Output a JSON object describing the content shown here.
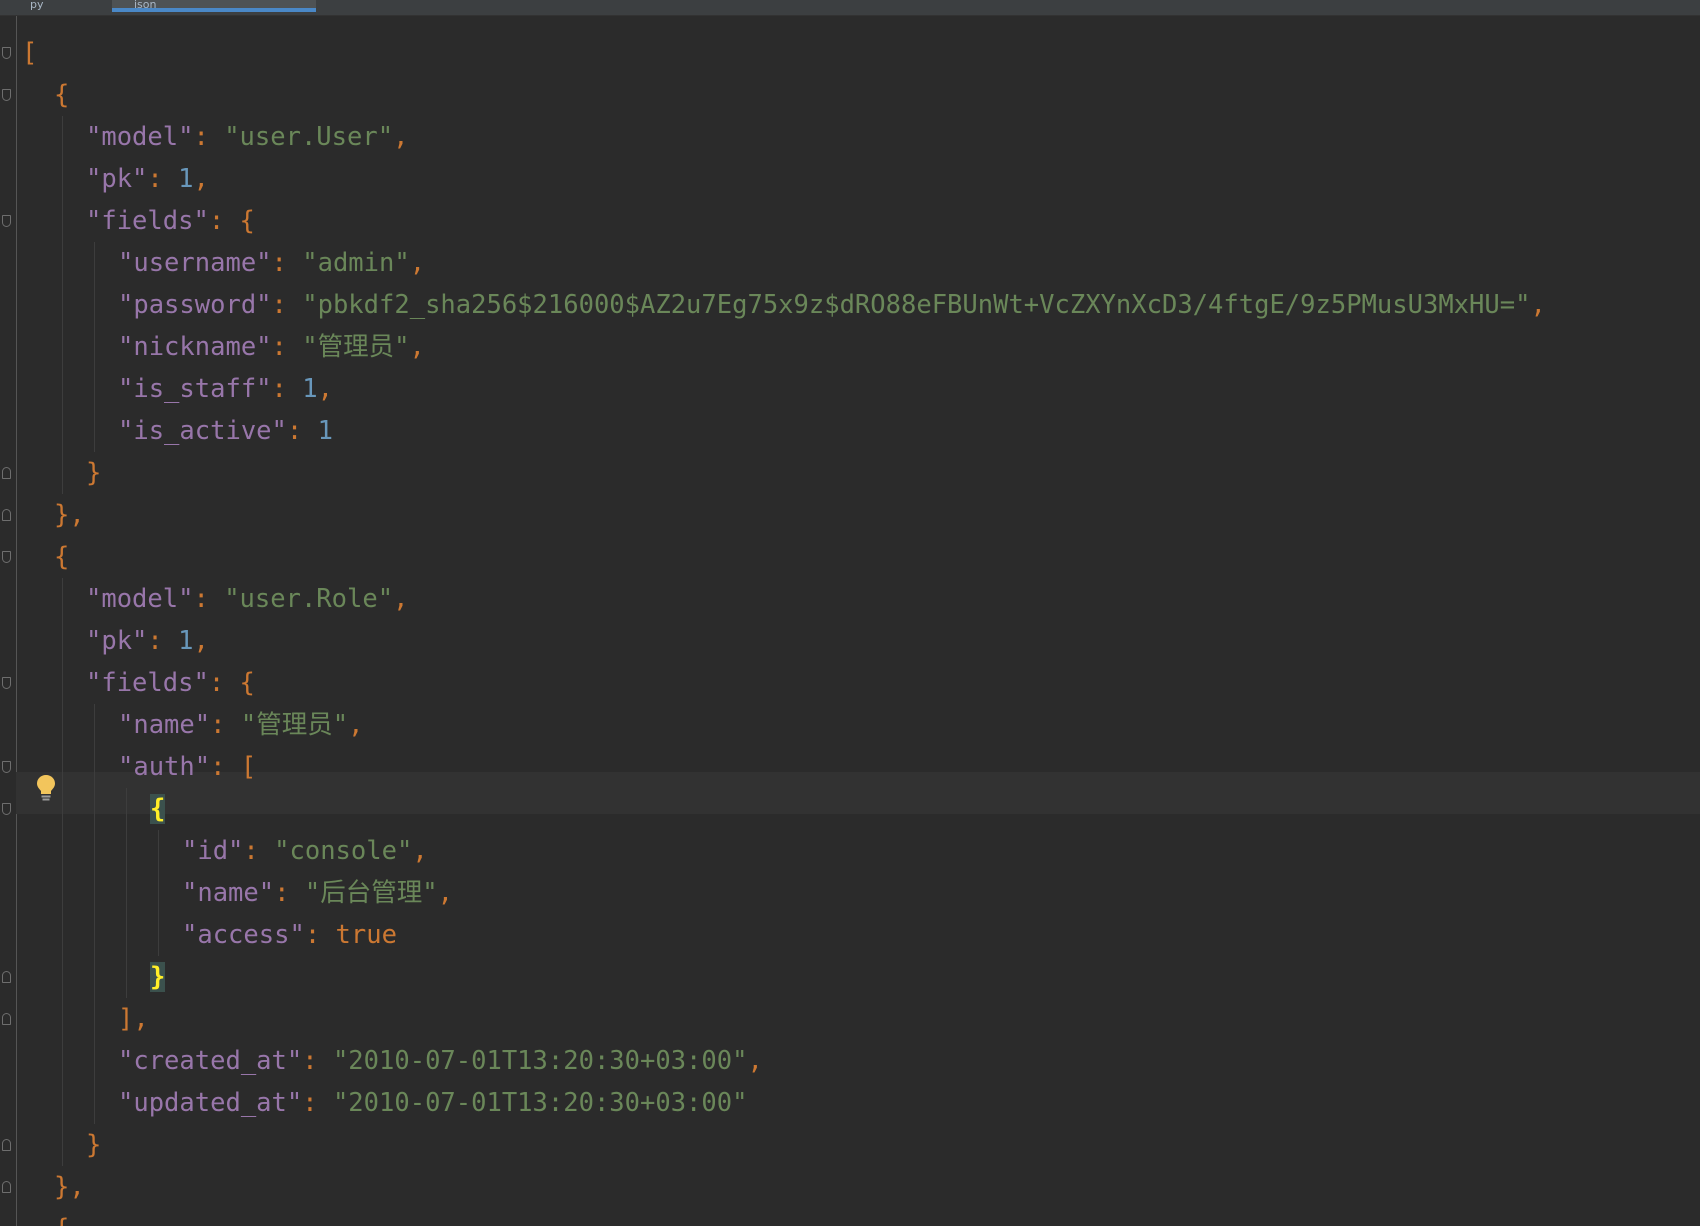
{
  "tabs": [
    {
      "label": "py"
    },
    {
      "label": "json"
    }
  ],
  "colors": {
    "background": "#2b2b2b",
    "key": "#9876aa",
    "string": "#6a8759",
    "number": "#6897bb",
    "keyword": "#cc7832",
    "active_tab_underline": "#4a88c7"
  },
  "editor": {
    "lines": [
      {
        "indent": 0,
        "tokens": [
          {
            "t": "[",
            "c": "p"
          }
        ]
      },
      {
        "indent": 1,
        "tokens": [
          {
            "t": "{",
            "c": "p"
          }
        ]
      },
      {
        "indent": 2,
        "tokens": [
          {
            "t": "\"model\"",
            "c": "k"
          },
          {
            "t": ": ",
            "c": "b"
          },
          {
            "t": "\"user.User\"",
            "c": "s"
          },
          {
            "t": ",",
            "c": "b"
          }
        ]
      },
      {
        "indent": 2,
        "tokens": [
          {
            "t": "\"pk\"",
            "c": "k"
          },
          {
            "t": ": ",
            "c": "b"
          },
          {
            "t": "1",
            "c": "n"
          },
          {
            "t": ",",
            "c": "b"
          }
        ]
      },
      {
        "indent": 2,
        "tokens": [
          {
            "t": "\"fields\"",
            "c": "k"
          },
          {
            "t": ": ",
            "c": "b"
          },
          {
            "t": "{",
            "c": "p"
          }
        ]
      },
      {
        "indent": 3,
        "tokens": [
          {
            "t": "\"username\"",
            "c": "k"
          },
          {
            "t": ": ",
            "c": "b"
          },
          {
            "t": "\"admin\"",
            "c": "s"
          },
          {
            "t": ",",
            "c": "b"
          }
        ]
      },
      {
        "indent": 3,
        "tokens": [
          {
            "t": "\"password\"",
            "c": "k"
          },
          {
            "t": ": ",
            "c": "b"
          },
          {
            "t": "\"pbkdf2_sha256$216000$AZ2u7Eg75x9z$dRO88eFBUnWt+VcZXYnXcD3/4ftgE/9z5PMusU3MxHU=\"",
            "c": "s"
          },
          {
            "t": ",",
            "c": "b"
          }
        ]
      },
      {
        "indent": 3,
        "tokens": [
          {
            "t": "\"nickname\"",
            "c": "k"
          },
          {
            "t": ": ",
            "c": "b"
          },
          {
            "t": "\"管理员\"",
            "c": "s"
          },
          {
            "t": ",",
            "c": "b"
          }
        ]
      },
      {
        "indent": 3,
        "tokens": [
          {
            "t": "\"is_staff\"",
            "c": "k"
          },
          {
            "t": ": ",
            "c": "b"
          },
          {
            "t": "1",
            "c": "n"
          },
          {
            "t": ",",
            "c": "b"
          }
        ]
      },
      {
        "indent": 3,
        "tokens": [
          {
            "t": "\"is_active\"",
            "c": "k"
          },
          {
            "t": ": ",
            "c": "b"
          },
          {
            "t": "1",
            "c": "n"
          }
        ]
      },
      {
        "indent": 2,
        "tokens": [
          {
            "t": "}",
            "c": "p"
          }
        ]
      },
      {
        "indent": 1,
        "tokens": [
          {
            "t": "}",
            "c": "p"
          },
          {
            "t": ",",
            "c": "b"
          }
        ]
      },
      {
        "indent": 1,
        "tokens": [
          {
            "t": "{",
            "c": "p"
          }
        ]
      },
      {
        "indent": 2,
        "tokens": [
          {
            "t": "\"model\"",
            "c": "k"
          },
          {
            "t": ": ",
            "c": "b"
          },
          {
            "t": "\"user.Role\"",
            "c": "s"
          },
          {
            "t": ",",
            "c": "b"
          }
        ]
      },
      {
        "indent": 2,
        "tokens": [
          {
            "t": "\"pk\"",
            "c": "k"
          },
          {
            "t": ": ",
            "c": "b"
          },
          {
            "t": "1",
            "c": "n"
          },
          {
            "t": ",",
            "c": "b"
          }
        ]
      },
      {
        "indent": 2,
        "tokens": [
          {
            "t": "\"fields\"",
            "c": "k"
          },
          {
            "t": ": ",
            "c": "b"
          },
          {
            "t": "{",
            "c": "p"
          }
        ]
      },
      {
        "indent": 3,
        "tokens": [
          {
            "t": "\"name\"",
            "c": "k"
          },
          {
            "t": ": ",
            "c": "b"
          },
          {
            "t": "\"管理员\"",
            "c": "s"
          },
          {
            "t": ",",
            "c": "b"
          }
        ]
      },
      {
        "indent": 3,
        "tokens": [
          {
            "t": "\"auth\"",
            "c": "k"
          },
          {
            "t": ": ",
            "c": "b"
          },
          {
            "t": "[",
            "c": "p"
          }
        ]
      },
      {
        "indent": 4,
        "tokens": [
          {
            "t": "{",
            "c": "brace-hl"
          }
        ]
      },
      {
        "indent": 5,
        "tokens": [
          {
            "t": "\"id\"",
            "c": "k"
          },
          {
            "t": ": ",
            "c": "b"
          },
          {
            "t": "\"console\"",
            "c": "s"
          },
          {
            "t": ",",
            "c": "b"
          }
        ]
      },
      {
        "indent": 5,
        "tokens": [
          {
            "t": "\"name\"",
            "c": "k"
          },
          {
            "t": ": ",
            "c": "b"
          },
          {
            "t": "\"后台管理\"",
            "c": "s"
          },
          {
            "t": ",",
            "c": "b"
          }
        ]
      },
      {
        "indent": 5,
        "tokens": [
          {
            "t": "\"access\"",
            "c": "k"
          },
          {
            "t": ": ",
            "c": "b"
          },
          {
            "t": "true",
            "c": "b"
          }
        ]
      },
      {
        "indent": 4,
        "tokens": [
          {
            "t": "}",
            "c": "brace-hl"
          }
        ]
      },
      {
        "indent": 3,
        "tokens": [
          {
            "t": "]",
            "c": "p"
          },
          {
            "t": ",",
            "c": "b"
          }
        ]
      },
      {
        "indent": 3,
        "tokens": [
          {
            "t": "\"created_at\"",
            "c": "k"
          },
          {
            "t": ": ",
            "c": "b"
          },
          {
            "t": "\"2010-07-01T13:20:30+03:00\"",
            "c": "s"
          },
          {
            "t": ",",
            "c": "b"
          }
        ]
      },
      {
        "indent": 3,
        "tokens": [
          {
            "t": "\"updated_at\"",
            "c": "k"
          },
          {
            "t": ": ",
            "c": "b"
          },
          {
            "t": "\"2010-07-01T13:20:30+03:00\"",
            "c": "s"
          }
        ]
      },
      {
        "indent": 2,
        "tokens": [
          {
            "t": "}",
            "c": "p"
          }
        ]
      },
      {
        "indent": 1,
        "tokens": [
          {
            "t": "}",
            "c": "p"
          },
          {
            "t": ",",
            "c": "b"
          }
        ]
      },
      {
        "indent": 1,
        "tokens": [
          {
            "t": "{",
            "c": "p"
          }
        ]
      }
    ],
    "fold_open_lines": [
      0,
      1,
      4,
      12,
      15,
      17,
      18
    ],
    "fold_close_lines": [
      10,
      11,
      22,
      23,
      26,
      27
    ],
    "caret_line": 18,
    "intention_icon": "lightbulb-icon"
  }
}
